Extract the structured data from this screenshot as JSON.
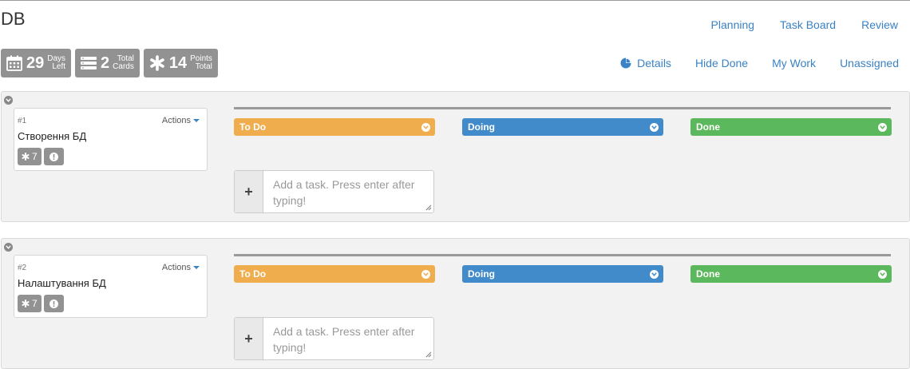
{
  "header": {
    "title": "DB"
  },
  "nav": {
    "planning": "Planning",
    "task_board": "Task Board",
    "review": "Review"
  },
  "subnav": {
    "details": "Details",
    "hide_done": "Hide Done",
    "my_work": "My Work",
    "unassigned": "Unassigned"
  },
  "stats": [
    {
      "icon": "calendar-icon",
      "value": "29",
      "label_top": "Days",
      "label_bottom": "Left"
    },
    {
      "icon": "cards-icon",
      "value": "2",
      "label_top": "Total",
      "label_bottom": "Cards"
    },
    {
      "icon": "asterisk-icon",
      "value": "14",
      "label_top": "Points",
      "label_bottom": "Total"
    }
  ],
  "lanes": {
    "todo": "To Do",
    "doing": "Doing",
    "done": "Done"
  },
  "add_task": {
    "button": "+",
    "placeholder": "Add a task. Press enter after typing!"
  },
  "stories": [
    {
      "number": "#1",
      "actions": "Actions",
      "name": "Створення БД",
      "points": "7"
    },
    {
      "number": "#2",
      "actions": "Actions",
      "name": "Налаштування БД",
      "points": "7"
    }
  ],
  "colors": {
    "todo": "#f0ad4e",
    "doing": "#428bca",
    "done": "#5cb85c",
    "link": "#3a82c4",
    "badge": "#929292"
  }
}
